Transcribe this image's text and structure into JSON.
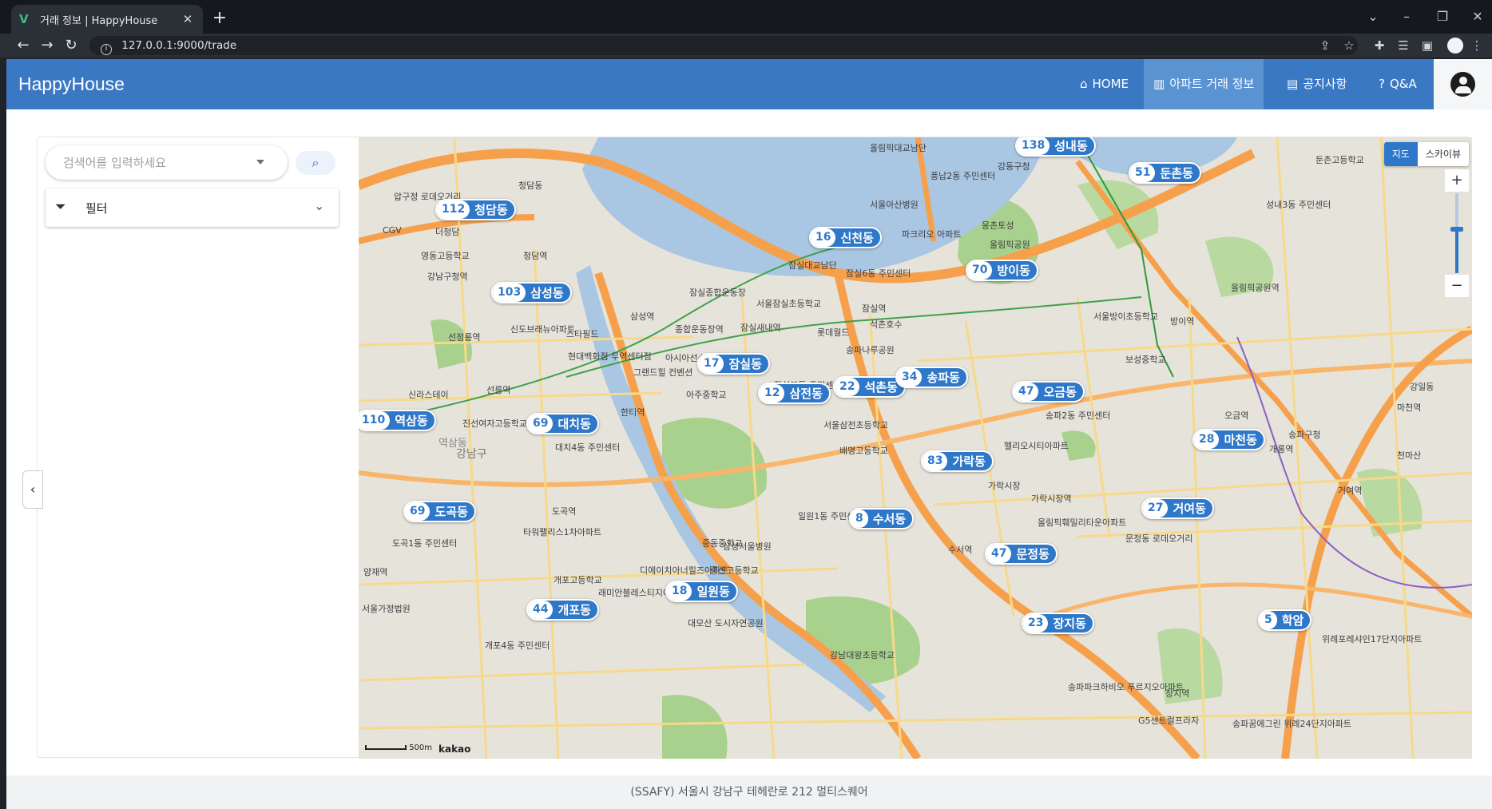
{
  "browser": {
    "tab_title": "거래 정보 | HappyHouse",
    "tab_favicon": "V",
    "url": "127.0.0.1:9000/trade"
  },
  "appbar": {
    "brand": "HappyHouse",
    "nav": [
      {
        "icon": "home-icon",
        "label": "HOME"
      },
      {
        "icon": "building-icon",
        "label": "아파트 거래 정보"
      },
      {
        "icon": "notice-icon",
        "label": "공지사항"
      },
      {
        "icon": "question-icon",
        "label": "Q&A"
      }
    ]
  },
  "sidebar": {
    "search_placeholder": "검색어를 입력하세요",
    "filter_label": "필터"
  },
  "map": {
    "type_buttons": [
      "지도",
      "스카이뷰"
    ],
    "zoom_in": "+",
    "zoom_out": "−",
    "scale": "500m",
    "attribution": "kakao",
    "clusters": [
      {
        "count": "138",
        "name": "성내동"
      },
      {
        "count": "51",
        "name": "둔촌동"
      },
      {
        "count": "112",
        "name": "청담동"
      },
      {
        "count": "16",
        "name": "신천동"
      },
      {
        "count": "70",
        "name": "방이동"
      },
      {
        "count": "103",
        "name": "삼성동"
      },
      {
        "count": "17",
        "name": "잠실동"
      },
      {
        "count": "12",
        "name": "삼전동"
      },
      {
        "count": "22",
        "name": "석촌동"
      },
      {
        "count": "34",
        "name": "송파동"
      },
      {
        "count": "47",
        "name": "오금동"
      },
      {
        "count": "110",
        "name": "역삼동"
      },
      {
        "count": "69",
        "name": "대치동"
      },
      {
        "count": "28",
        "name": "마천동"
      },
      {
        "count": "83",
        "name": "가락동"
      },
      {
        "count": "69",
        "name": "도곡동"
      },
      {
        "count": "8",
        "name": "수서동"
      },
      {
        "count": "27",
        "name": "거여동"
      },
      {
        "count": "47",
        "name": "문정동"
      },
      {
        "count": "18",
        "name": "일원동"
      },
      {
        "count": "44",
        "name": "개포동"
      },
      {
        "count": "23",
        "name": "장지동"
      },
      {
        "count": "5",
        "name": "학암"
      }
    ],
    "labels": [
      "강동구청",
      "올림픽대교남단",
      "풍납2동 주민센터",
      "서울아산병원",
      "몽촌토성",
      "올림픽공원",
      "파크리오 아파트",
      "잠실대교남단",
      "잠실6동 주민센터",
      "잠실역",
      "롯데월드",
      "석촌호수",
      "송파나루공원",
      "잠실종합운동장",
      "종합운동장역",
      "서울잠실초등학교",
      "잠실새내역",
      "아시아선수촌아파트",
      "잠실본동 주민센터",
      "아주중학교",
      "서울삼전초등학교",
      "배명고등학교",
      "헬리오시티아파트",
      "가락시장",
      "가락시장역",
      "올림픽훼밀리타운아파트",
      "문정동 로데오거리",
      "수서역",
      "삼성서울병원",
      "중동중학교",
      "일원1동 주민센터",
      "중산고등학교",
      "대모산 도시자연공원",
      "강남대왕초등학교",
      "래미안블레스티지아파트",
      "디에이치아너힐즈아파트",
      "개포고등학교",
      "타워팰리스1차아파트",
      "도곡역",
      "대치4동 주민센터",
      "한티역",
      "선릉역",
      "선정릉역",
      "신도브래뉴아파트",
      "스타필드",
      "현대백화점 무역센터점",
      "그랜드힐 컨벤션",
      "삼성역",
      "영동고등학교",
      "강남구청역",
      "청담역",
      "청담동",
      "더청담",
      "CGV",
      "압구정 로데오거리",
      "신라스테이",
      "진선여자고등학교",
      "강남구",
      "역삼동",
      "도곡1동 주민센터",
      "양재역",
      "서울가정법원",
      "개포4동 주민센터",
      "방이역",
      "올림픽공원역",
      "서울방이초등학교",
      "보성중학교",
      "송파2동 주민센터",
      "오금역",
      "개롱역",
      "거여역",
      "마천역",
      "송파구청",
      "장지역",
      "송파파크하비오 푸르지오아파트",
      "G5센트럴프라자",
      "송파꿈에그린 위례24단지아파트",
      "위례포레샤인17단지아파트",
      "성내3동 주민센터",
      "둔촌고등학교",
      "강일동",
      "천마산"
    ]
  },
  "footer": "(SSAFY) 서울시 강남구 테헤란로 212 멀티스퀘어",
  "colors": {
    "appbar": "#3b78c4",
    "nav_active": "#5a93d2",
    "cluster": "#2f78c9",
    "river": "#a9c6e3",
    "park": "#a9d18e",
    "road_major": "#f6a04c"
  }
}
